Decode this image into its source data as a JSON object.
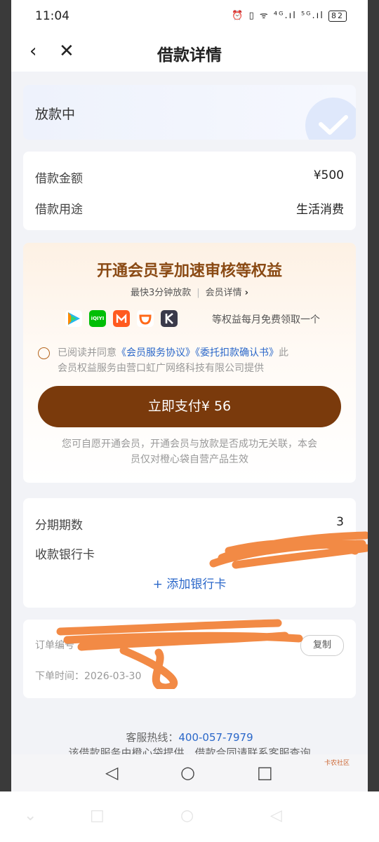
{
  "status_bar": {
    "time": "11:04",
    "icons_text": "⏰ ▯ ᯤ ⁴ᴳ.ıl ⁵ᴳ.ıl",
    "battery": "82"
  },
  "nav": {
    "title": "借款详情"
  },
  "loan_status": "放款中",
  "loan_info": {
    "amount_label": "借款金额",
    "amount_value": "¥500",
    "purpose_label": "借款用途",
    "purpose_value": "生活消费"
  },
  "membership": {
    "title": "开通会员享加速审核等权益",
    "fast_text": "最快3分钟放款",
    "details_link": "会员详情",
    "benefit_text": "等权益每月免费领取一个",
    "agree_prefix": "已阅读并同意",
    "agreement_1": "《会员服务协议》",
    "agreement_2": "《委托扣款确认书》",
    "agree_suffix": "此",
    "provider_text": "会员权益服务由营口虹广网络科技有限公司提供",
    "pay_button": "立即支付¥ 56",
    "disclaimer_line1": "您可自愿开通会员，开通会员与放款是否成功无关联，本会",
    "disclaimer_line2": "员仅对橙心袋自营产品生效",
    "app_icons": [
      "tencent-video-icon",
      "iqiyi-icon",
      "mango-tv-icon",
      "didi-icon",
      "kuaishou-k-icon"
    ],
    "app_iqiyi_label": "iQIYI"
  },
  "loan_details": {
    "installments_label": "分期期数",
    "installments_value": "3",
    "bank_card_label": "收款银行卡",
    "add_bank_card": "+ 添加银行卡"
  },
  "order": {
    "order_no_label": "订单编号",
    "copy_button": "复制",
    "order_time_label": "下单时间：",
    "order_time_value": "2026-03-30"
  },
  "footer": {
    "hotline_label": "客服热线：",
    "hotline_number": "400-057-7979",
    "note": "该借款服务由橙心袋提供，借款合同请联系客服查询"
  },
  "watermark": "卡农社区",
  "colors": {
    "brand_brown": "#7a3a0c",
    "title_brown": "#8a4a14",
    "link_blue": "#2a67c9",
    "scribble_orange": "#f28a45"
  }
}
